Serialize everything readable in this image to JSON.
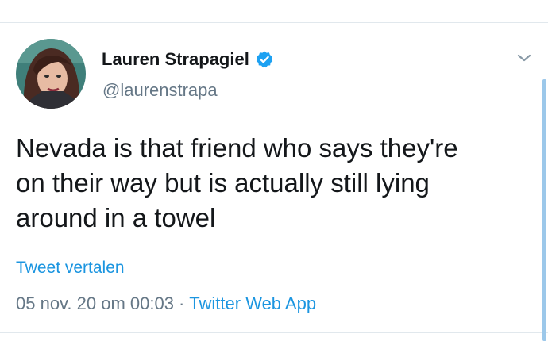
{
  "tweet": {
    "author": {
      "display_name": "Lauren Strapagiel",
      "handle": "@laurenstrapa",
      "verified": true
    },
    "text_lines": [
      "Nevada is that friend who says they're",
      "on their way but is actually still lying",
      "around in a towel"
    ],
    "translate_label": "Tweet vertalen",
    "timestamp": "05 nov. 20 om 00:03",
    "separator": "·",
    "source": "Twitter Web App"
  },
  "icons": {
    "verified": "verified-badge-icon",
    "more": "chevron-down-icon"
  },
  "colors": {
    "text_primary": "#14171a",
    "text_secondary": "#657786",
    "link": "#1b95e0",
    "verified": "#1da1f2",
    "divider": "#e1e8ed"
  }
}
